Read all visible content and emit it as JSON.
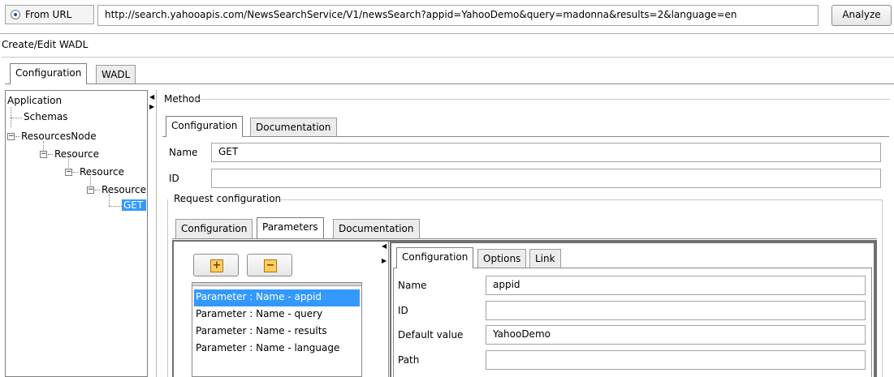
{
  "source": {
    "radio_label": "From URL",
    "url": "http://search.yahooapis.com/NewsSearchService/V1/newsSearch?appid=YahooDemo&query=madonna&results=2&language=en",
    "analyze_label": "Analyze"
  },
  "section_title": "Create/Edit WADL",
  "top_tabs": [
    "Configuration",
    "WADL"
  ],
  "tree": {
    "application": "Application",
    "schemas": "Schemas",
    "resources_node": "ResourcesNode",
    "resource1": "Resource",
    "resource2": "Resource",
    "resource3": "Resource",
    "get": "GET"
  },
  "method": {
    "group_title": "Method",
    "tabs": [
      "Configuration",
      "Documentation"
    ],
    "name_label": "Name",
    "name_value": "GET",
    "id_label": "ID",
    "id_value": ""
  },
  "request": {
    "group_title": "Request configuration",
    "tabs": [
      "Configuration",
      "Parameters",
      "Documentation"
    ]
  },
  "parameters": {
    "add_symbol": "+",
    "remove_symbol": "−",
    "items": [
      "Parameter : Name - appid",
      "Parameter : Name - query",
      "Parameter : Name - results",
      "Parameter : Name - language"
    ]
  },
  "param_detail": {
    "tabs": [
      "Configuration",
      "Options",
      "Link"
    ],
    "name_label": "Name",
    "name_value": "appid",
    "id_label": "ID",
    "id_value": "",
    "default_label": "Default value",
    "default_value": "YahooDemo",
    "path_label": "Path",
    "path_value": ""
  },
  "colors": {
    "selection": "#3399ff",
    "button_icon": "#e8a020"
  }
}
